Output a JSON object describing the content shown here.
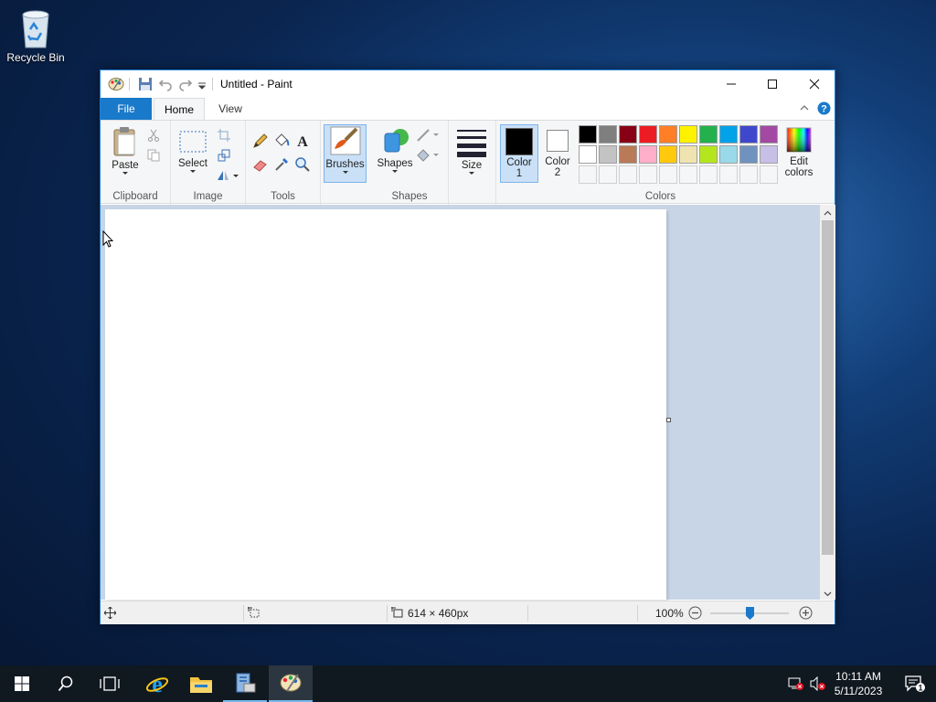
{
  "desktop": {
    "recycle_bin_label": "Recycle Bin"
  },
  "window": {
    "title": "Untitled - Paint",
    "tabs": {
      "file": "File",
      "home": "Home",
      "view": "View"
    }
  },
  "ribbon": {
    "clipboard": {
      "label": "Clipboard",
      "paste": "Paste"
    },
    "image": {
      "label": "Image",
      "select": "Select"
    },
    "tools": {
      "label": "Tools"
    },
    "brushes": {
      "label": "Brushes"
    },
    "shapes": {
      "label": "Shapes",
      "button": "Shapes"
    },
    "size": {
      "label": "Size"
    },
    "colors": {
      "label": "Colors",
      "color1": "Color",
      "color1_num": "1",
      "color2": "Color",
      "color2_num": "2",
      "edit": "Edit",
      "edit2": "colors",
      "color1_value": "#000000",
      "color2_value": "#ffffff",
      "palette_row1": [
        "#000000",
        "#7f7f7f",
        "#880015",
        "#ed1c24",
        "#ff7f27",
        "#fff200",
        "#22b14c",
        "#00a2e8",
        "#3f48cc",
        "#a349a4"
      ],
      "palette_row2": [
        "#ffffff",
        "#c3c3c3",
        "#b97a57",
        "#ffaec9",
        "#ffc90e",
        "#efe4b0",
        "#b5e61d",
        "#99d9ea",
        "#7092be",
        "#c8bfe7"
      ]
    }
  },
  "status": {
    "dimensions": "614 × 460px",
    "zoom": "100%"
  },
  "taskbar": {
    "time": "10:11 AM",
    "date": "5/11/2023",
    "notification_count": "1"
  }
}
